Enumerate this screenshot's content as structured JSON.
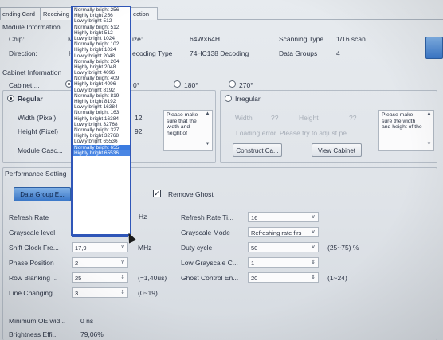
{
  "tabs": [
    "ending Card",
    "Receiving",
    "ection"
  ],
  "module_info": {
    "title": "Module Information",
    "chip_label": "Chip:",
    "chip_value": "M",
    "size_label": "ize:",
    "size_value": "64W×64H",
    "scan_type_label": "Scanning Type",
    "scan_type_value": "1/16 scan",
    "direction_label": "Direction:",
    "direction_value": "H",
    "decoding_label": "ecoding Type",
    "decoding_value": "74HC138 Decoding",
    "data_groups_label": "Data Groups",
    "data_groups_value": "4"
  },
  "cabinet_info": {
    "title": "Cabinet Information",
    "cabinet_label": "Cabinet ...",
    "rot_90": "0°",
    "rot_180": "180°",
    "rot_270": "270°",
    "regular_label": "Regular",
    "irregular_label": "Irregular",
    "width_label": "Width (Pixel)",
    "width_value": "12",
    "height_label": "Height (Pixel)",
    "height_value": "92",
    "module_cascade_label": "Module Casc...",
    "note_left": "Please make sure that the width and height of",
    "irr_width_label": "Width",
    "irr_width_value": "??",
    "irr_height_label": "Height",
    "irr_height_value": "??",
    "loading_error": "Loading error. Please try to adjust pe...",
    "note_right": "Please make sure the width and height of the",
    "construct_button": "Construct Ca...",
    "view_button": "View Cabinet"
  },
  "performance": {
    "title": "Performance Setting",
    "data_group_button": "Data Group E...",
    "remove_ghost_label": "Remove Ghost",
    "refresh_rate_label": "Refresh Rate",
    "refresh_rate_unit": "Hz",
    "refresh_rate_times_label": "Refresh Rate Ti...",
    "refresh_rate_times_value": "16",
    "grayscale_level_label": "Grayscale level",
    "grayscale_level_value": "Normally bright",
    "grayscale_mode_label": "Grayscale Mode",
    "grayscale_mode_value": "Refreshing rate firs",
    "shift_clock_label": "Shift Clock Fre...",
    "shift_clock_value": "17,9",
    "shift_clock_unit": "MHz",
    "duty_cycle_label": "Duty cycle",
    "duty_cycle_value": "50",
    "duty_cycle_range": "(25~75) %",
    "phase_label": "Phase Position",
    "phase_value": "2",
    "low_grayscale_label": "Low Grayscale C...",
    "low_grayscale_value": "1",
    "row_blanking_label": "Row Blanking ...",
    "row_blanking_value": "25",
    "row_blanking_note": "(=1,40us)",
    "ghost_control_label": "Ghost Control En...",
    "ghost_control_value": "20",
    "ghost_control_range": "(1~24)",
    "line_changing_label": "Line Changing ...",
    "line_changing_value": "3",
    "line_changing_range": "(0~19)",
    "min_oe_label": "Minimum OE wid...",
    "min_oe_value": "0 ns",
    "brightness_label": "Brightness Effi...",
    "brightness_value": "79,06%"
  },
  "dropdown_options": [
    "Normally bright 256",
    "Highly bright 256",
    "Lowly bright 512",
    "Normally bright 512",
    "Highly bright 512",
    "Lowly bright 1024",
    "Normally bright 102",
    "Highly bright 1024",
    "Lowly bright 2048",
    "Normally bright 204",
    "Highly bright 2048",
    "Lowly bright 4096",
    "Normally bright 409",
    "Highly bright 4096",
    "Lowly bright 8192",
    "Normally bright 819",
    "Highly bright 8192",
    "Lowly bright 16384",
    "Normally bright 163",
    "Highly bright 16384",
    "Lowly bright 32768",
    "Normally bright 327",
    "Highly bright 32768",
    "Lowly bright 65536",
    "Normally bright 655",
    "Highly bright 65536"
  ],
  "dropdown_selected_index": 24,
  "accent_color": "#3b7be0"
}
